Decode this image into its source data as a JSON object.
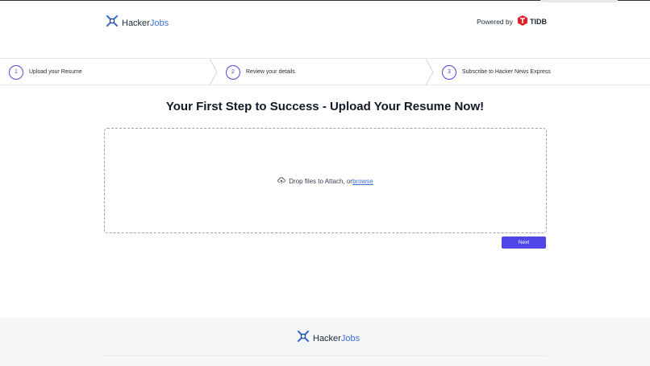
{
  "header": {
    "logo": {
      "prefix": "Hacker",
      "accent": "Jobs"
    },
    "powered_by": "Powered by",
    "partner": "TIDB"
  },
  "steps": [
    {
      "number": "1",
      "label": "Upload your Resume"
    },
    {
      "number": "2",
      "label": "Review your details"
    },
    {
      "number": "3",
      "label": "Subscribe to Hacker News Express"
    }
  ],
  "main": {
    "title": "Your First Step to Success - Upload Your Resume Now!",
    "drop_text": "Drop files to Attach, or",
    "browse_label": "browse",
    "next_label": "Next"
  },
  "footer": {
    "logo": {
      "prefix": "Hacker",
      "accent": "Jobs"
    }
  },
  "colors": {
    "primary": "#4f46e5",
    "link": "#3b6fd6",
    "tidb_red": "#e11d2a"
  },
  "icons": [
    "hackerjobs-logo-icon",
    "tidb-logo-icon",
    "upload-cloud-icon"
  ]
}
